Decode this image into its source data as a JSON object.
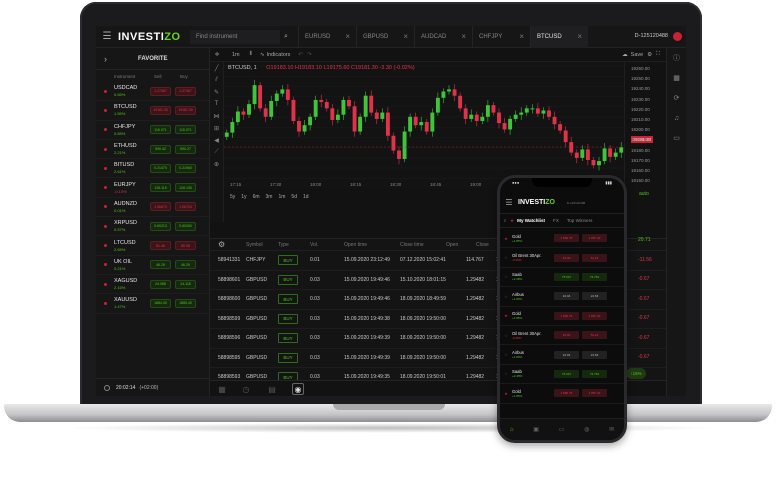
{
  "app": {
    "logo_part1": "INVESTI",
    "logo_part2": "ZO",
    "account_id": "D-125120488",
    "search_placeholder": "Find instrument"
  },
  "tabs": [
    {
      "label": "EURUSD",
      "active": false
    },
    {
      "label": "GBPUSD",
      "active": false
    },
    {
      "label": "AUDCAD",
      "active": false
    },
    {
      "label": "CHFJPY",
      "active": false
    },
    {
      "label": "BTCUSD",
      "active": true
    }
  ],
  "sidebar": {
    "title": "FAVORITE",
    "columns": [
      "Instrument",
      "Sell",
      "Buy"
    ],
    "items": [
      {
        "symbol": "USDCAD",
        "change": "0.65%",
        "dir": "up",
        "sell": "1.27467",
        "buy": "1.27467",
        "sell_color": "r",
        "buy_color": "r"
      },
      {
        "symbol": "BTCUSD",
        "change": "1.55%",
        "dir": "up",
        "sell": "19181.30",
        "buy": "19181.30",
        "sell_color": "r",
        "buy_color": "r"
      },
      {
        "symbol": "CHFJPY",
        "change": "0.65%",
        "dir": "up",
        "sell": "115.071",
        "buy": "115.071",
        "sell_color": "g",
        "buy_color": "g"
      },
      {
        "symbol": "ETHUSD",
        "change": "2.21%",
        "dir": "up",
        "sell": "590.42",
        "buy": "590.27",
        "sell_color": "g",
        "buy_color": "g"
      },
      {
        "symbol": "BITUSD",
        "change": "2.61%",
        "dir": "up",
        "sell": "0.21470",
        "buy": "0.21960",
        "sell_color": "g",
        "buy_color": "g"
      },
      {
        "symbol": "EURJPY",
        "change": "-0.10%",
        "dir": "down",
        "sell": "126.115",
        "buy": "126.135",
        "sell_color": "g",
        "buy_color": "g"
      },
      {
        "symbol": "AUDNZD",
        "change": "0.01%",
        "dir": "up",
        "sell": "1.06670",
        "buy": "1.06704",
        "sell_color": "r",
        "buy_color": "r"
      },
      {
        "symbol": "XRPUSD",
        "change": "0.57%",
        "dir": "up",
        "sell": "0.60213",
        "buy": "0.60260",
        "sell_color": "g",
        "buy_color": "g"
      },
      {
        "symbol": "LTCUSD",
        "change": "2.65%",
        "dir": "up",
        "sell": "81.46",
        "buy": "80.08",
        "sell_color": "r",
        "buy_color": "r"
      },
      {
        "symbol": "UK OIL",
        "change": "0.21%",
        "dir": "up",
        "sell": "46.29",
        "buy": "46.29",
        "sell_color": "g",
        "buy_color": "g"
      },
      {
        "symbol": "XAGUSD",
        "change": "2.15%",
        "dir": "up",
        "sell": "24.088",
        "buy": "24.118",
        "sell_color": "g",
        "buy_color": "g"
      },
      {
        "symbol": "XAUUSD",
        "change": "1.47%",
        "dir": "up",
        "sell": "1884.30",
        "buy": "1885.40",
        "sell_color": "g",
        "buy_color": "g"
      }
    ],
    "clock": "20:02:14",
    "timezone": "(+02:00)"
  },
  "chart_toolbar": {
    "interval": "1m",
    "indicators_label": "Indicators",
    "save_label": "Save"
  },
  "chart_data": {
    "type": "candlestick",
    "symbol_label": "BTCUSD, 1",
    "ohlc_text": "O19183.10 H19183.10 L19175.60 C19181.30 -3.30 (-0.02%)",
    "price_ticks": [
      "19260.00",
      "19250.00",
      "19240.00",
      "19230.00",
      "19220.00",
      "19210.00",
      "19200.00",
      "19190.00",
      "19180.00",
      "19170.00",
      "19160.00",
      "19150.00"
    ],
    "current_price": "19181.30",
    "time_ticks": [
      "17:15",
      "17:30",
      "18:00",
      "18:15",
      "18:30",
      "18:45",
      "19:00",
      "19:15",
      "19:30"
    ],
    "periods": [
      "5y",
      "1y",
      "6m",
      "3m",
      "1m",
      "5d",
      "1d"
    ],
    "close": [
      19195,
      19205,
      19215,
      19212,
      19222,
      19240,
      19218,
      19210,
      19225,
      19232,
      19236,
      19226,
      19206,
      19196,
      19202,
      19210,
      19226,
      19224,
      19218,
      19207,
      19212,
      19226,
      19220,
      19196,
      19210,
      19230,
      19214,
      19208,
      19214,
      19192,
      19178,
      19170,
      19196,
      19210,
      19202,
      19205,
      19196,
      19214,
      19228,
      19234,
      19236,
      19230,
      19218,
      19208,
      19212,
      19206,
      19210,
      19221,
      19214,
      19204,
      19198,
      19208,
      19212,
      19214,
      19218,
      19218,
      19213,
      19216,
      19210,
      19203,
      19197,
      19186,
      19176,
      19171,
      19179,
      19169,
      19164,
      19168,
      19180,
      19172,
      19176,
      19181
    ]
  },
  "orders": {
    "columns": [
      "Symbol",
      "Type",
      "Vol.",
      "Open time",
      "Close time",
      "Open",
      "Close"
    ],
    "rows": [
      {
        "id": "58941331",
        "symbol": "CHFJPY",
        "type": "BUY",
        "vol": "0.01",
        "open_time": "15.09.2020 23:12:49",
        "close_time": "07.12.2020 15:02:41",
        "open": "114.767",
        "close": "115.0"
      },
      {
        "id": "58898601",
        "symbol": "GBPUSD",
        "type": "BUY",
        "vol": "0.03",
        "open_time": "15.09.2020 19:49:46",
        "close_time": "15.10.2020 18:01:15",
        "open": "1.29482",
        "close": "1.290"
      },
      {
        "id": "58898600",
        "symbol": "GBPUSD",
        "type": "BUY",
        "vol": "0.03",
        "open_time": "15.09.2020 19:49:46",
        "close_time": "18.09.2020 18:49:59",
        "open": "1.29482",
        "close": "1.290"
      },
      {
        "id": "58898599",
        "symbol": "GBPUSD",
        "type": "BUY",
        "vol": "0.03",
        "open_time": "15.09.2020 19:49:38",
        "close_time": "18.09.2020 19:50:00",
        "open": "1.29482",
        "close": "1.290"
      },
      {
        "id": "58898596",
        "symbol": "GBPUSD",
        "type": "BUY",
        "vol": "0.03",
        "open_time": "15.09.2020 19:49:39",
        "close_time": "18.09.2020 19:50:00",
        "open": "1.29482",
        "close": "1.290"
      },
      {
        "id": "58898595",
        "symbol": "GBPUSD",
        "type": "BUY",
        "vol": "0.03",
        "open_time": "15.09.2020 19:49:39",
        "close_time": "18.09.2020 19:50:00",
        "open": "1.29482",
        "close": "1.290"
      },
      {
        "id": "58898593",
        "symbol": "GBPUSD",
        "type": "BUY",
        "vol": "0.03",
        "open_time": "15.09.2020 19:49:35",
        "close_time": "18.09.2020 19:50:01",
        "open": "1.29482",
        "close": "1.290"
      }
    ],
    "peek_values": [
      "20.71",
      "-11.56",
      "-0.67",
      "-0.67",
      "-0.67",
      "-0.67",
      "-0.67"
    ]
  },
  "status_bar": {
    "margin_label": "USE MARGIN",
    "margin_value": "20.18",
    "free_funds_label": "FREE FUNDS",
    "free_funds_value": "9889.67",
    "auto_label": "auto"
  },
  "phone": {
    "logo": "INVESTIZO",
    "account": "D-125120488",
    "tabs": [
      "My Watchlist",
      "FX",
      "Top Winners"
    ],
    "rows": [
      {
        "symbol": "Gold",
        "change": "+1.85%",
        "dir": "up",
        "sell": "1 886.75",
        "buy": "1 887.40",
        "cs": "r",
        "cb": "r",
        "fav": true
      },
      {
        "symbol": "Oil Brent 30Apr.",
        "change": "-0.45%",
        "dir": "down",
        "sell": "54.06",
        "buy": "54.24",
        "cs": "r",
        "cb": "r",
        "fav": false
      },
      {
        "symbol": "Saab",
        "change": "+2.48%",
        "dir": "up",
        "sell": "75.637",
        "buy": "76.763",
        "cs": "g",
        "cb": "g",
        "fav": false
      },
      {
        "symbol": "Airbus",
        "change": "+1.80%",
        "dir": "up",
        "sell": "24.04",
        "buy": "24.66",
        "cs": "n",
        "cb": "n",
        "fav": false
      },
      {
        "symbol": "Gold",
        "change": "+1.85%",
        "dir": "up",
        "sell": "1 886.75",
        "buy": "1 887.40",
        "cs": "r",
        "cb": "r",
        "fav": true
      },
      {
        "symbol": "Oil Brent 30Apr.",
        "change": "-0.45%",
        "dir": "down",
        "sell": "54.06",
        "buy": "54.24",
        "cs": "r",
        "cb": "r",
        "fav": false
      },
      {
        "symbol": "Airbus",
        "change": "+1.80%",
        "dir": "up",
        "sell": "24.04",
        "buy": "24.66",
        "cs": "n",
        "cb": "n",
        "fav": false
      },
      {
        "symbol": "Saab",
        "change": "+2.48%",
        "dir": "up",
        "sell": "75.637",
        "buy": "76.763",
        "cs": "g",
        "cb": "g",
        "fav": false
      },
      {
        "symbol": "Gold",
        "change": "+1.85%",
        "dir": "up",
        "sell": "1 886.75",
        "buy": "1 887.40",
        "cs": "r",
        "cb": "r",
        "fav": true
      }
    ]
  },
  "colors": {
    "accent": "#52c41a",
    "down": "#e0334b",
    "brand_red": "#c82333"
  }
}
